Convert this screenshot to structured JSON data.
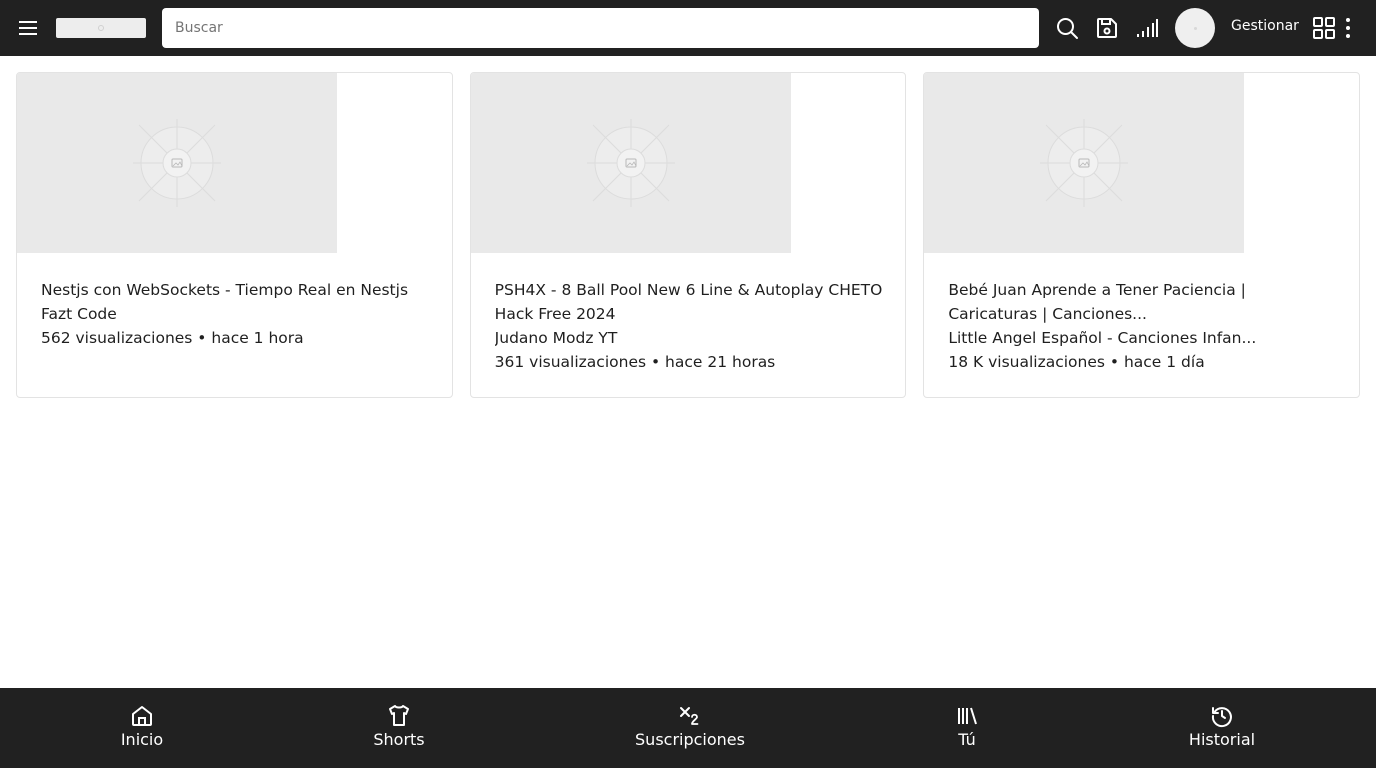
{
  "header": {
    "search_placeholder": "Buscar",
    "manage_label": "Gestionar",
    "icons": [
      "menu-icon",
      "search-icon",
      "save-icon",
      "signal-icon",
      "avatar",
      "apps-grid-icon",
      "more-vert-icon"
    ]
  },
  "videos": [
    {
      "title_line1": "Nestjs con WebSockets - Tiempo Real en Nestjs",
      "title_line2": "",
      "channel": "Fazt Code",
      "meta": "562 visualizaciones • hace 1 hora"
    },
    {
      "title_line1": "PSH4X - 8 Ball Pool New 6 Line & Autoplay CHETO",
      "title_line2": "Hack Free 2024",
      "channel": "Judano Modz YT",
      "meta": "361 visualizaciones • hace 21 horas"
    },
    {
      "title_line1": "Bebé Juan Aprende a Tener Paciencia |",
      "title_line2": "Caricaturas | Canciones...",
      "channel": "Little Angel Español - Canciones Infan...",
      "meta": "18 K visualizaciones • hace 1 día"
    }
  ],
  "bottom_nav": {
    "items": [
      {
        "label": "Inicio",
        "icon": "home-icon"
      },
      {
        "label": "Shorts",
        "icon": "shirt-icon"
      },
      {
        "label": "Suscripciones",
        "icon": "subscript-icon"
      },
      {
        "label": "Tú",
        "icon": "library-icon"
      },
      {
        "label": "Historial",
        "icon": "history-icon"
      }
    ]
  },
  "colors": {
    "bar_background": "#212121",
    "thumbnail_placeholder": "#e9e9e9",
    "text": "#1f1f1f"
  }
}
